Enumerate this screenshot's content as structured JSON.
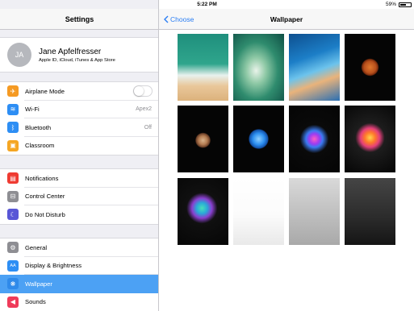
{
  "status_bar": {
    "device": "iPad",
    "time": "5:22 PM",
    "battery_percent": "59%",
    "battery_level": 0.59
  },
  "sidebar": {
    "title": "Settings",
    "account": {
      "initials": "JA",
      "name": "Jane Apfelfresser",
      "subtitle": "Apple ID, iCloud, iTunes & App Store"
    },
    "groups": [
      [
        {
          "name": "airplane-mode",
          "label": "Airplane Mode",
          "icon": "airplane-icon",
          "icon_color": "#f59a23",
          "glyph": "✈",
          "toggle": false
        },
        {
          "name": "wifi",
          "label": "Wi-Fi",
          "icon": "wifi-icon",
          "icon_color": "#2d8ef4",
          "glyph": "≋",
          "value": "Apex2"
        },
        {
          "name": "bluetooth",
          "label": "Bluetooth",
          "icon": "bluetooth-icon",
          "icon_color": "#2d8ef4",
          "glyph": "ᛒ",
          "value": "Off"
        },
        {
          "name": "classroom",
          "label": "Classroom",
          "icon": "classroom-icon",
          "icon_color": "#f5a623",
          "glyph": "▣"
        }
      ],
      [
        {
          "name": "notifications",
          "label": "Notifications",
          "icon": "notifications-icon",
          "icon_color": "#ef3b32",
          "glyph": "▤"
        },
        {
          "name": "control-center",
          "label": "Control Center",
          "icon": "control-center-icon",
          "icon_color": "#8e8e93",
          "glyph": "⊟"
        },
        {
          "name": "do-not-disturb",
          "label": "Do Not Disturb",
          "icon": "moon-icon",
          "icon_color": "#5856d6",
          "glyph": "☾"
        }
      ],
      [
        {
          "name": "general",
          "label": "General",
          "icon": "gear-icon",
          "icon_color": "#8e8e93",
          "glyph": "⚙"
        },
        {
          "name": "display-brightness",
          "label": "Display & Brightness",
          "icon": "display-icon",
          "icon_color": "#2d8ef4",
          "glyph": "AA"
        },
        {
          "name": "wallpaper",
          "label": "Wallpaper",
          "icon": "wallpaper-icon",
          "icon_color": "#34aadc",
          "glyph": "❋",
          "selected": true
        },
        {
          "name": "sounds",
          "label": "Sounds",
          "icon": "speaker-icon",
          "icon_color": "#ef3b5a",
          "glyph": "◀"
        }
      ]
    ]
  },
  "main": {
    "back_label": "Choose",
    "title": "Wallpaper",
    "wallpapers": [
      {
        "name": "wallpaper-beach-waves",
        "bg": "linear-gradient(180deg,#1f8f7d 0%,#2fa58c 45%,#e8f1ee 62%,#e9c79a 78%,#dcb27c 100%)"
      },
      {
        "name": "wallpaper-green-wave",
        "bg": "radial-gradient(ellipse at 45% 55%,#e9f3ea 0%,#8fc9a6 25%,#2f8c6e 55%,#0f4f45 100%)"
      },
      {
        "name": "wallpaper-blue-wave",
        "bg": "linear-gradient(160deg,#0e4f8f 0%,#1c7ec7 35%,#6cc3ec 55%,#e9b37b 70%,#2a6fb3 100%)"
      },
      {
        "name": "wallpaper-mars",
        "bg": "radial-gradient(circle at 50% 50%,#e0782e 0%,#b9501c 14%,#7a2c0d 19%,#050505 21%,#050505 100%)"
      },
      {
        "name": "wallpaper-jupiter",
        "bg": "radial-gradient(circle at 50% 52%,#d9b48c 0%,#b47c52 10%,#6b3f27 16%,#050505 18%,#050505 100%)"
      },
      {
        "name": "wallpaper-neptune",
        "bg": "radial-gradient(circle at 50% 50%,#8fd0ff 0%,#2b8ef0 14%,#124fa6 22%,#050505 24%,#050505 100%)"
      },
      {
        "name": "wallpaper-purple-burst",
        "bg": "radial-gradient(circle at 50% 50%,#ff5ec2 0%,#9f3cf0 12%,#3a7af0 20%,#0a0a0a 34%,#050505 100%)"
      },
      {
        "name": "wallpaper-orange-burst",
        "bg": "radial-gradient(circle at 50% 48%,#ffd34d 0%,#ff7a2a 12%,#e53f7b 22%,#1d1d1d 34%,#050505 100%)"
      },
      {
        "name": "wallpaper-teal-burst",
        "bg": "radial-gradient(circle at 48% 45%,#48e0b8 0%,#2aa9d8 12%,#8a3fd0 22%,#101010 34%,#060606 100%)"
      },
      {
        "name": "wallpaper-white-gradient",
        "bg": "linear-gradient(180deg,#ffffff 0%,#fbfbfb 55%,#e9e9e9 100%)"
      },
      {
        "name": "wallpaper-gray-gradient",
        "bg": "linear-gradient(180deg,#d9d9d9 0%,#bcbcbc 60%,#a9a9a9 100%)"
      },
      {
        "name": "wallpaper-dark-gradient",
        "bg": "linear-gradient(180deg,#454545 0%,#2b2b2b 60%,#151515 100%)"
      }
    ]
  }
}
